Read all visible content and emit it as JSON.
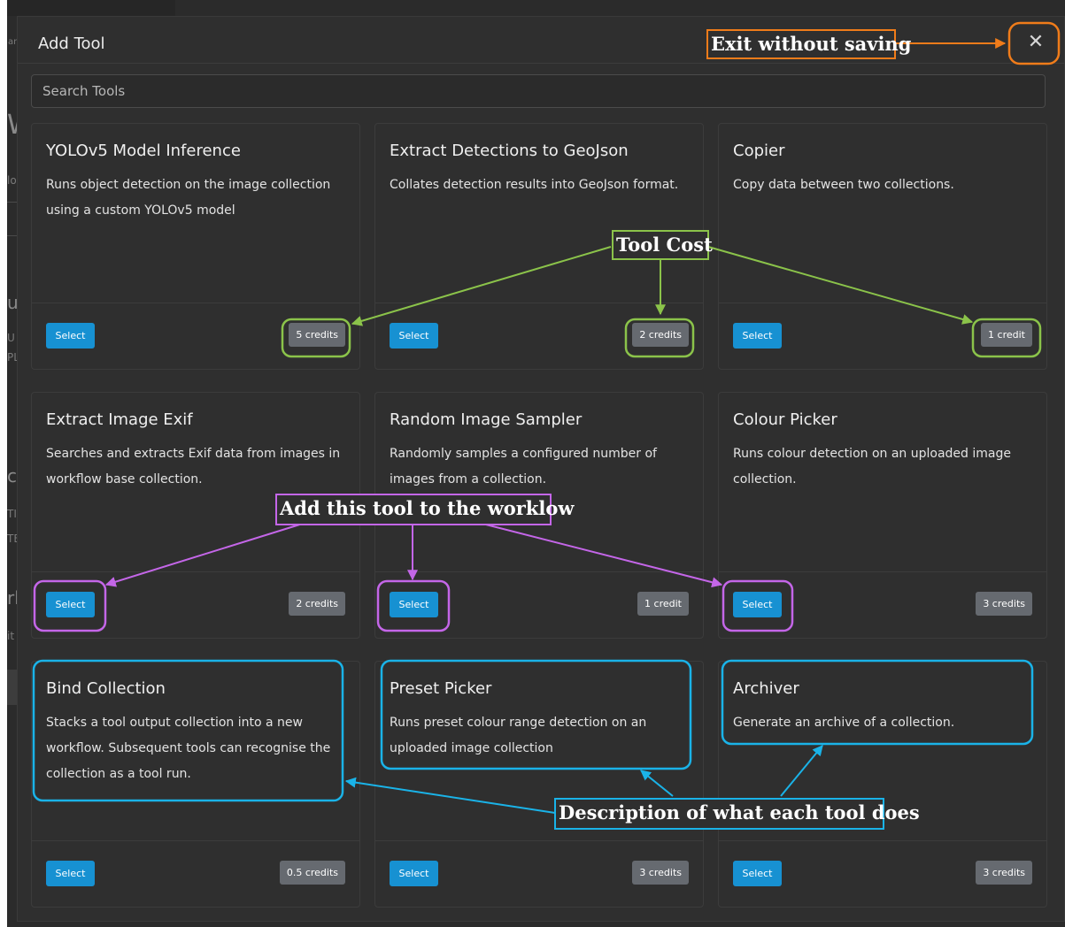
{
  "modal": {
    "title": "Add Tool",
    "search_placeholder": "Search Tools",
    "close_icon": "x-icon"
  },
  "tools": [
    {
      "title": "YOLOv5 Model Inference",
      "description": "Runs object detection on the image collection using a custom YOLOv5 model",
      "select_label": "Select",
      "credits": "5 credits"
    },
    {
      "title": "Extract Detections to GeoJson",
      "description": "Collates detection results into GeoJson format.",
      "select_label": "Select",
      "credits": "2 credits"
    },
    {
      "title": "Copier",
      "description": "Copy data between two collections.",
      "select_label": "Select",
      "credits": "1 credit"
    },
    {
      "title": "Extract Image Exif",
      "description": "Searches and extracts Exif data from images in workflow base collection.",
      "select_label": "Select",
      "credits": "2 credits"
    },
    {
      "title": "Random Image Sampler",
      "description": "Randomly samples a configured number of images from a collection.",
      "select_label": "Select",
      "credits": "1 credit"
    },
    {
      "title": "Colour Picker",
      "description": "Runs colour detection on an uploaded image collection.",
      "select_label": "Select",
      "credits": "3 credits"
    },
    {
      "title": "Bind Collection",
      "description": "Stacks a tool output collection into a new workflow. Subsequent tools can recognise the collection as a tool run.",
      "select_label": "Select",
      "credits": "0.5 credits"
    },
    {
      "title": "Preset Picker",
      "description": "Runs preset colour range detection on an uploaded image collection",
      "select_label": "Select",
      "credits": "3 credits"
    },
    {
      "title": "Archiver",
      "description": "Generate an archive of a collection.",
      "select_label": "Select",
      "credits": "3 credits"
    }
  ],
  "annotations": {
    "exit": {
      "text": "Exit without saving",
      "color": "#f07c1a"
    },
    "cost": {
      "text": "Tool Cost",
      "color": "#8bc34a"
    },
    "select": {
      "text": "Add this tool to the worklow",
      "color": "#c466e8"
    },
    "description": {
      "text": "Description of what each tool does",
      "color": "#1ab3e8"
    }
  },
  "background_fragments": [
    "ar",
    "W",
    "lo",
    "u",
    "U",
    "PL",
    "c",
    "TI",
    "TE",
    "rl",
    "it"
  ]
}
